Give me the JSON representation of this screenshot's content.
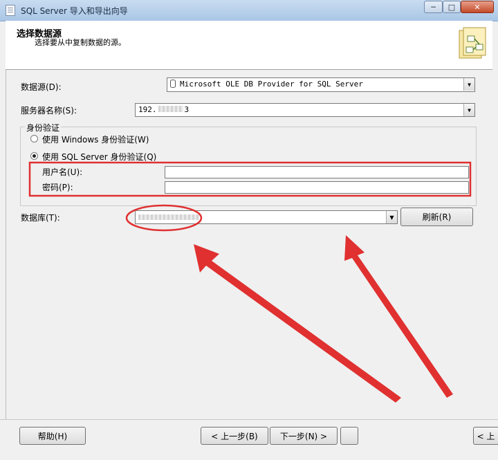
{
  "window": {
    "title": "SQL Server 导入和导出向导",
    "min_glyph": "─",
    "max_glyph": "□",
    "close_glyph": "✕"
  },
  "header": {
    "title": "选择数据源",
    "subtitle": "选择要从中复制数据的源。",
    "icon": "wizard-icon"
  },
  "form": {
    "datasource_label": "数据源(D):",
    "datasource_value": "Microsoft OLE DB Provider for SQL Server",
    "server_label": "服务器名称(S):",
    "server_value": "192.",
    "server_suffix": "3",
    "auth_group_label": "身份验证",
    "windows_auth_label": "使用 Windows 身份验证(W)",
    "sql_auth_label": "使用 SQL Server 身份验证(Q)",
    "username_label": "用户名(U):",
    "username_value": "",
    "password_label": "密码(P):",
    "password_value": "",
    "database_label": "数据库(T):",
    "database_value": "",
    "refresh_button": "刷新(R)",
    "dropdown_glyph": "▼"
  },
  "footer": {
    "help_button": "帮助(H)",
    "back_button": "< 上一步(B)",
    "next_button": "下一步(N) >",
    "last_button": "< 上"
  },
  "colors": {
    "annotation": "#e03030"
  }
}
